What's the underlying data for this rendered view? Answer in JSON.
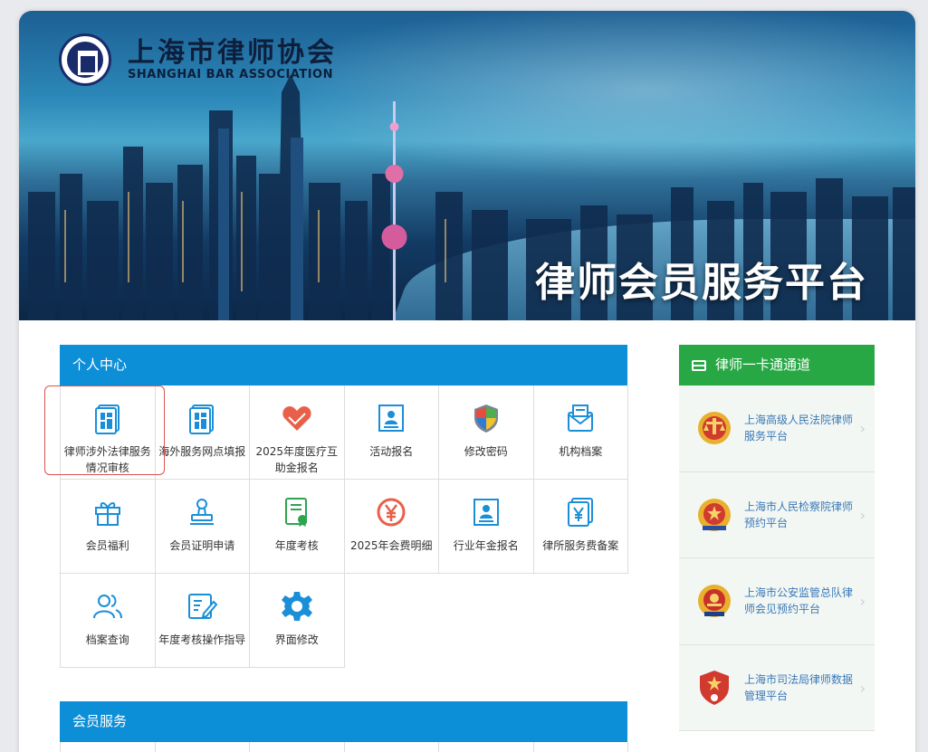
{
  "banner": {
    "org_name_cn": "上海市律师协会",
    "org_name_en": "SHANGHAI BAR ASSOCIATION",
    "platform_title": "律师会员服务平台"
  },
  "personal_center": {
    "title": "个人中心",
    "items": [
      {
        "label": "律师涉外法律服务情况审核",
        "icon": "form-grid-icon",
        "color": "#1a8fd8"
      },
      {
        "label": "海外服务网点填报",
        "icon": "form-grid-icon",
        "color": "#1a8fd8"
      },
      {
        "label": "2025年度医疗互助金报名",
        "icon": "heart-hands-icon",
        "color": "#e8604a"
      },
      {
        "label": "活动报名",
        "icon": "id-card-icon",
        "color": "#1a8fd8"
      },
      {
        "label": "修改密码",
        "icon": "shield-icon",
        "color": "#3b7bd6"
      },
      {
        "label": "机构档案",
        "icon": "envelope-icon",
        "color": "#1a8fd8"
      },
      {
        "label": "会员福利",
        "icon": "gift-icon",
        "color": "#1a8fd8"
      },
      {
        "label": "会员证明申请",
        "icon": "stamp-icon",
        "color": "#1a8fd8"
      },
      {
        "label": "年度考核",
        "icon": "certificate-icon",
        "color": "#2da44e"
      },
      {
        "label": "2025年会费明细",
        "icon": "yen-coin-icon",
        "color": "#e8604a"
      },
      {
        "label": "行业年金报名",
        "icon": "id-card-icon",
        "color": "#1a8fd8"
      },
      {
        "label": "律所服务费备案",
        "icon": "yen-doc-icon",
        "color": "#1a8fd8"
      },
      {
        "label": "档案查询",
        "icon": "users-icon",
        "color": "#1a8fd8"
      },
      {
        "label": "年度考核操作指导",
        "icon": "edit-note-icon",
        "color": "#1a8fd8"
      },
      {
        "label": "界面修改",
        "icon": "gear-icon",
        "color": "#1a8fd8"
      }
    ]
  },
  "member_services": {
    "title": "会员服务"
  },
  "lawyer_card": {
    "title": "律师一卡通通道",
    "items": [
      {
        "label": "上海高级人民法院律师服务平台",
        "icon": "court-emblem-icon"
      },
      {
        "label": "上海市人民检察院律师预约平台",
        "icon": "procuratorate-emblem-icon"
      },
      {
        "label": "上海市公安监管总队律师会见预约平台",
        "icon": "police-emblem-icon"
      },
      {
        "label": "上海市司法局律师数据管理平台",
        "icon": "justice-emblem-icon"
      }
    ]
  }
}
